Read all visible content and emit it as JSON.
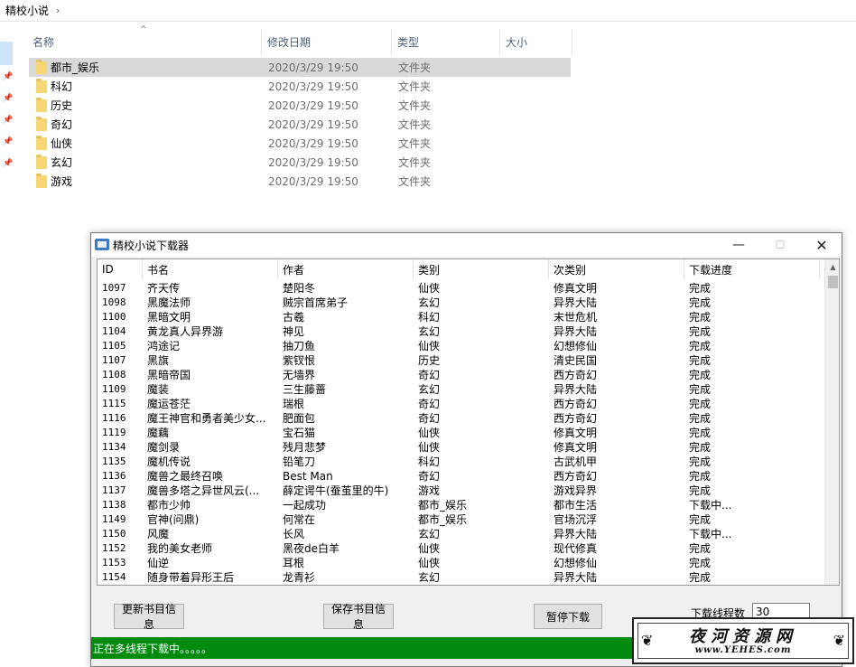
{
  "explorer": {
    "breadcrumb": "精校小说",
    "chevron": "›",
    "sort_arrow": "^",
    "columns": [
      "名称",
      "修改日期",
      "类型",
      "大小"
    ],
    "folders": [
      {
        "name": "都市_娱乐",
        "date": "2020/3/29 19:50",
        "type": "文件夹"
      },
      {
        "name": "科幻",
        "date": "2020/3/29 19:50",
        "type": "文件夹"
      },
      {
        "name": "历史",
        "date": "2020/3/29 19:50",
        "type": "文件夹"
      },
      {
        "name": "奇幻",
        "date": "2020/3/29 19:50",
        "type": "文件夹"
      },
      {
        "name": "仙侠",
        "date": "2020/3/29 19:50",
        "type": "文件夹"
      },
      {
        "name": "玄幻",
        "date": "2020/3/29 19:50",
        "type": "文件夹"
      },
      {
        "name": "游戏",
        "date": "2020/3/29 19:50",
        "type": "文件夹"
      }
    ]
  },
  "app": {
    "title": "精校小说下载器",
    "titlebar_buttons": {
      "minimize": "—",
      "maximize": "☐",
      "close": "✕"
    },
    "columns": [
      "ID",
      "书名",
      "作者",
      "类别",
      "次类别",
      "下载进度"
    ],
    "rows": [
      [
        "1097",
        "齐天传",
        "楚阳冬",
        "仙侠",
        "修真文明",
        "完成"
      ],
      [
        "1098",
        "黑魔法师",
        "贼宗首席弟子",
        "玄幻",
        "异界大陆",
        "完成"
      ],
      [
        "1100",
        "黑暗文明",
        "古羲",
        "科幻",
        "末世危机",
        "完成"
      ],
      [
        "1104",
        "黄龙真人异界游",
        "神见",
        "玄幻",
        "异界大陆",
        "完成"
      ],
      [
        "1105",
        "鸿途记",
        "抽刀鱼",
        "仙侠",
        "幻想修仙",
        "完成"
      ],
      [
        "1107",
        "黑旗",
        "紫钗恨",
        "历史",
        "清史民国",
        "完成"
      ],
      [
        "1108",
        "黑暗帝国",
        "无墙界",
        "奇幻",
        "西方奇幻",
        "完成"
      ],
      [
        "1109",
        "魔装",
        "三生藤蔷",
        "玄幻",
        "异界大陆",
        "完成"
      ],
      [
        "1115",
        "魔运苍茫",
        "瑞根",
        "奇幻",
        "西方奇幻",
        "完成"
      ],
      [
        "1116",
        "魔王神官和勇者美少女...",
        "肥面包",
        "奇幻",
        "西方奇幻",
        "完成"
      ],
      [
        "1119",
        "魔藕",
        "宝石猫",
        "仙侠",
        "修真文明",
        "完成"
      ],
      [
        "1134",
        "魔剑录",
        "残月悲梦",
        "仙侠",
        "修真文明",
        "完成"
      ],
      [
        "1135",
        "魔机传说",
        "铅笔刀",
        "科幻",
        "古武机甲",
        "完成"
      ],
      [
        "1136",
        "魔兽之最终召唤",
        "Best Man",
        "奇幻",
        "西方奇幻",
        "完成"
      ],
      [
        "1137",
        "魔兽多塔之异世风云(...",
        "薛定谔牛(蚕茧里的牛)",
        "游戏",
        "游戏异界",
        "完成"
      ],
      [
        "1138",
        "都市少帅",
        "一起成功",
        "都市_娱乐",
        "都市生活",
        "下载中..."
      ],
      [
        "1149",
        "官神(问鼎)",
        "何常在",
        "都市_娱乐",
        "官场沉浮",
        "完成"
      ],
      [
        "1150",
        "风魔",
        "长风",
        "玄幻",
        "异界大陆",
        "下载中..."
      ],
      [
        "1152",
        "我的美女老师",
        "黑夜de白羊",
        "仙侠",
        "现代修真",
        "完成"
      ],
      [
        "1153",
        "仙逆",
        "耳根",
        "仙侠",
        "幻想修仙",
        "完成"
      ],
      [
        "1154",
        "随身带着异形王后",
        "龙青衫",
        "玄幻",
        "异界大陆",
        "完成"
      ]
    ],
    "buttons": {
      "refresh": "更新书目信息",
      "save": "保存书目信息",
      "pause": "暂停下载"
    },
    "thread_label": "下载线程数",
    "thread_value": "30",
    "status": "正在多线程下载中。。。。。",
    "status_color": "#008a0e"
  },
  "watermark": {
    "cn": "夜河资源网",
    "url": "www.YEHES.com"
  }
}
